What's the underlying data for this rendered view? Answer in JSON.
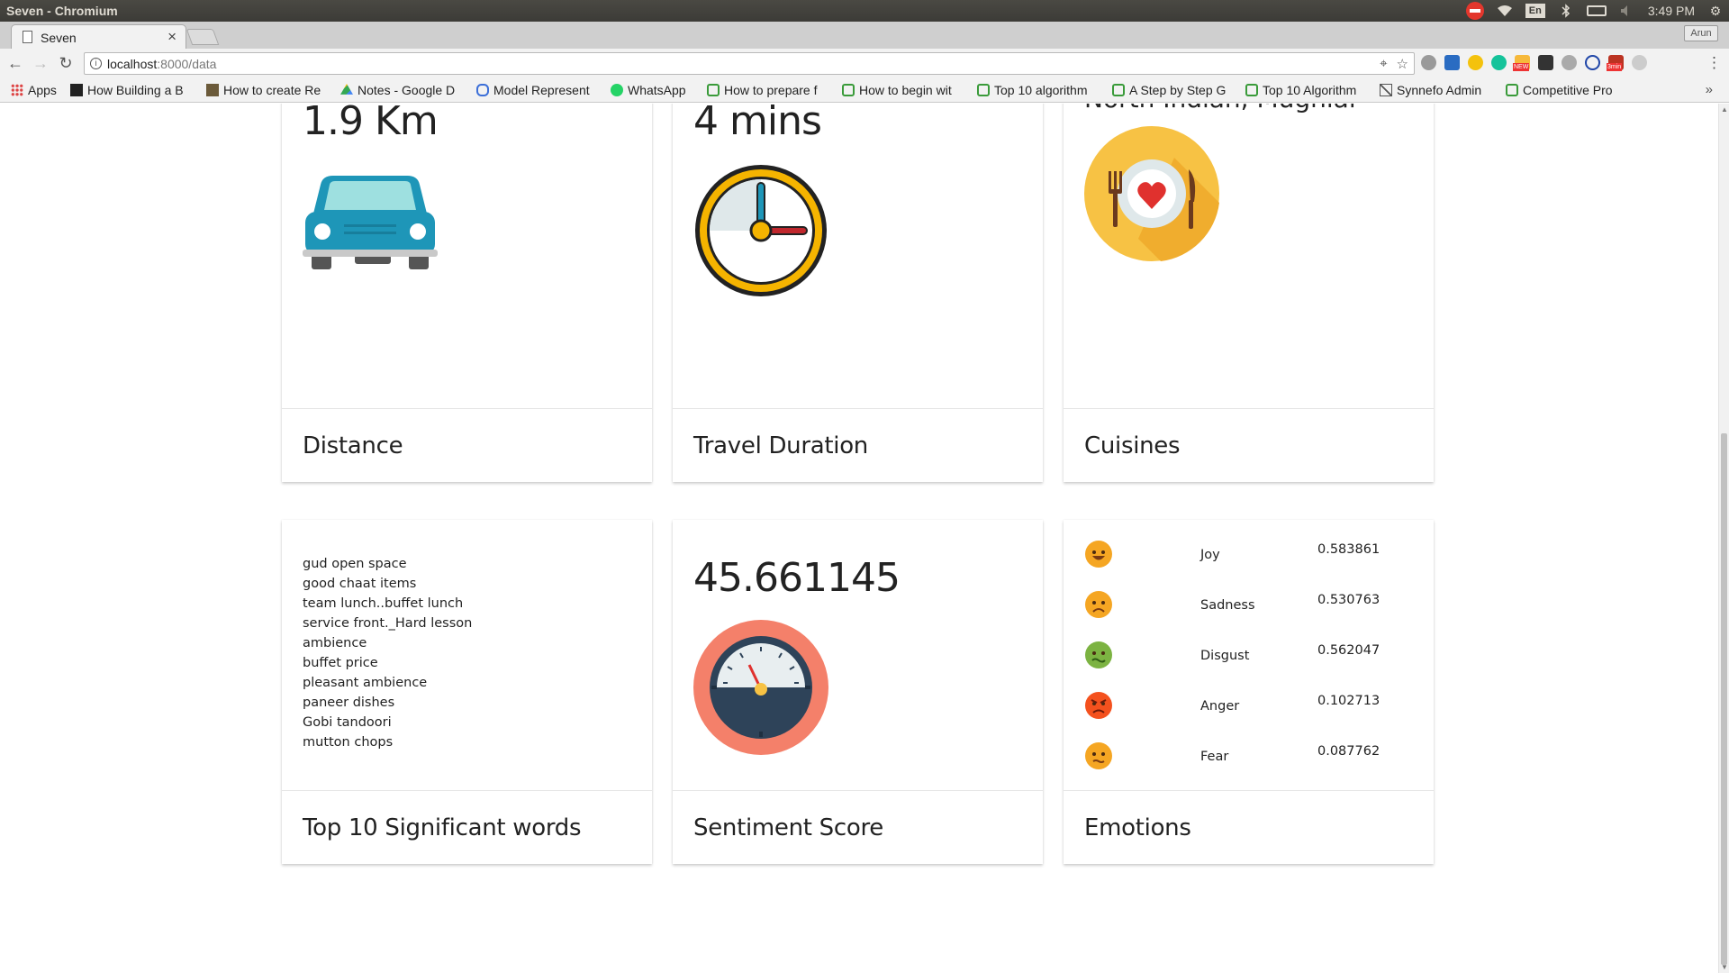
{
  "os": {
    "window_title": "Seven - Chromium",
    "keyboard_layout": "En",
    "clock": "3:49 PM"
  },
  "browser": {
    "tab_title": "Seven",
    "tab_close": "×",
    "profile_name": "Arun",
    "url_host": "localhost",
    "url_path": ":8000/data",
    "extension_badges": {
      "new": "NEW",
      "timer": "3min"
    },
    "bookmarks": [
      {
        "label": "Apps",
        "icon": "apps-grid-icon"
      },
      {
        "label": "How Building a B",
        "icon": "page-icon"
      },
      {
        "label": "How to create Re",
        "icon": "image-icon"
      },
      {
        "label": "Notes - Google D",
        "icon": "drive-icon"
      },
      {
        "label": "Model Represent",
        "icon": "infinity-icon"
      },
      {
        "label": "WhatsApp",
        "icon": "whatsapp-icon"
      },
      {
        "label": "How to prepare f",
        "icon": "hackerearth-icon"
      },
      {
        "label": "How to begin wit",
        "icon": "hackerearth-icon"
      },
      {
        "label": "Top 10 algorithm",
        "icon": "hackerearth-icon"
      },
      {
        "label": "A Step by Step G",
        "icon": "hackerearth-icon"
      },
      {
        "label": "Top 10 Algorithm",
        "icon": "hackerearth-icon"
      },
      {
        "label": "Synnefo Admin",
        "icon": "synnefo-icon"
      },
      {
        "label": "Competitive Pro",
        "icon": "hackerearth-icon"
      }
    ],
    "bookmarks_overflow": "»"
  },
  "cards": {
    "distance": {
      "value": "1.9 Km",
      "title": "Distance",
      "icon": "car-icon"
    },
    "travel_duration": {
      "value": "4 mins",
      "title": "Travel Duration",
      "icon": "clock-icon"
    },
    "cuisines": {
      "value": "North Indian, Mughlai",
      "title": "Cuisines",
      "icon": "plate-icon"
    },
    "significant_words": {
      "title": "Top 10 Significant words",
      "words": [
        "gud open space",
        "good chaat items",
        "team lunch..buffet lunch",
        "service front._Hard lesson",
        "ambience",
        "buffet price",
        "pleasant ambience",
        "paneer dishes",
        "Gobi tandoori",
        "mutton chops"
      ]
    },
    "sentiment": {
      "value": "45.661145",
      "title": "Sentiment Score",
      "icon": "speedometer-icon"
    },
    "emotions": {
      "title": "Emotions",
      "items": [
        {
          "label": "Joy",
          "value": "0.583861",
          "color": "#f5a623",
          "icon": "joy-face-icon"
        },
        {
          "label": "Sadness",
          "value": "0.530763",
          "color": "#f5a623",
          "icon": "sad-face-icon"
        },
        {
          "label": "Disgust",
          "value": "0.562047",
          "color": "#7cb342",
          "icon": "disgust-face-icon"
        },
        {
          "label": "Anger",
          "value": "0.102713",
          "color": "#f4511e",
          "icon": "angry-face-icon"
        },
        {
          "label": "Fear",
          "value": "0.087762",
          "color": "#f5a623",
          "icon": "fear-face-icon"
        }
      ]
    }
  }
}
